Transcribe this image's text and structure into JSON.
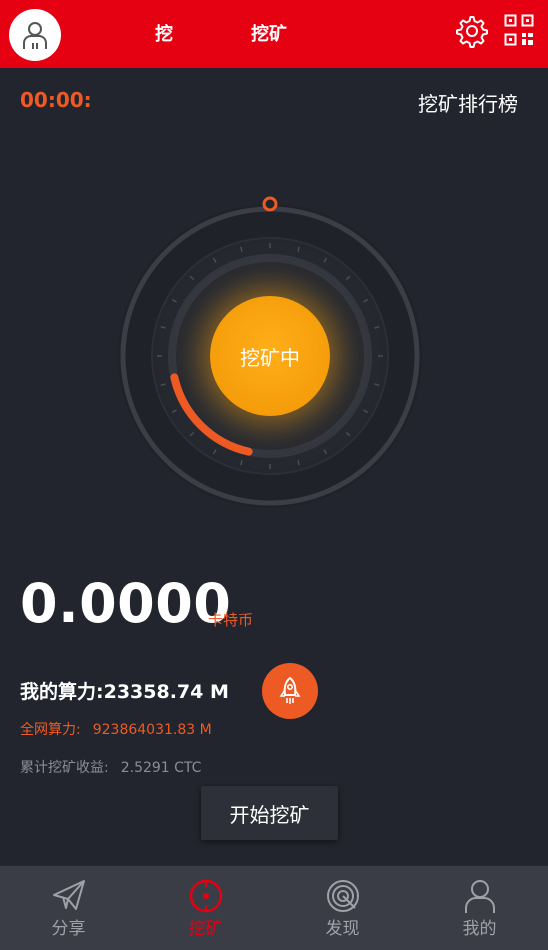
{
  "header": {
    "tabs": [
      "挖",
      "挖矿"
    ]
  },
  "top": {
    "timer": "00:00:",
    "rank_label": "挖矿排行榜"
  },
  "dial": {
    "status_label": "挖矿中",
    "progress_fraction": 0.18
  },
  "balance": {
    "value": "0.0000",
    "unit": "卡特币"
  },
  "stats": {
    "my_hashrate": "我的算力:23358.74 M",
    "network_label": "全网算力:",
    "network_value": "923864031.83 M",
    "cumulative_label": "累计挖矿收益:",
    "cumulative_value": "2.5291 CTC"
  },
  "start_button": "开始挖矿",
  "nav": [
    {
      "label": "分享",
      "icon": "paper-plane-icon"
    },
    {
      "label": "挖矿",
      "icon": "mining-target-icon"
    },
    {
      "label": "发现",
      "icon": "discover-spiral-icon"
    },
    {
      "label": "我的",
      "icon": "user-icon"
    }
  ],
  "colors": {
    "brand_red": "#e50012",
    "accent_orange": "#ee5a24",
    "dial_orange": "#f59d0a",
    "background": "#22252d"
  }
}
